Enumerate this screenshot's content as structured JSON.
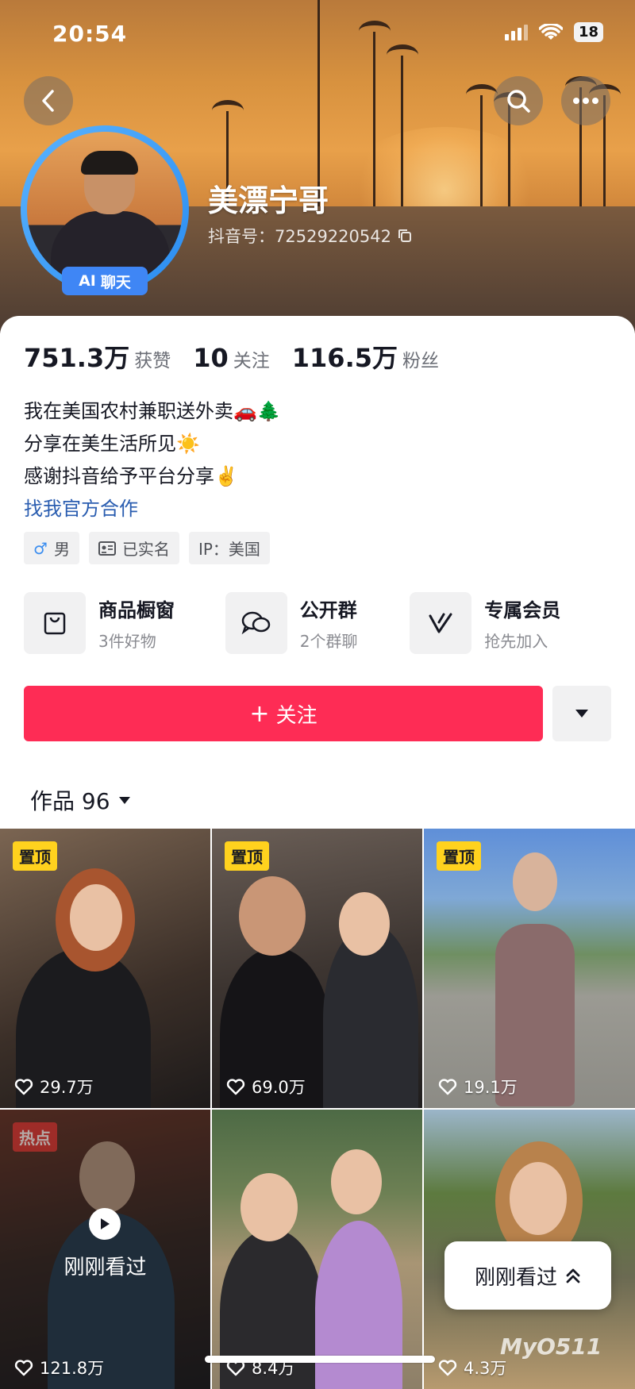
{
  "status": {
    "time": "20:54",
    "battery": "18"
  },
  "profile": {
    "name": "美漂宁哥",
    "douyin_id": "抖音号：72529220542",
    "ai_chat": "聊天",
    "ai_prefix": "AI"
  },
  "stats": [
    {
      "num": "751.3万",
      "label": "获赞"
    },
    {
      "num": "10",
      "label": "关注"
    },
    {
      "num": "116.5万",
      "label": "粉丝"
    }
  ],
  "bio": {
    "line1": "我在美国农村兼职送外卖🚗🌲",
    "line2": "分享在美生活所见☀️",
    "line3": "感谢抖音给予平台分享✌️",
    "link": "找我官方合作"
  },
  "tags": {
    "gender_symbol": "♂",
    "gender": "男",
    "verified": "已实名",
    "ip": "IP：美国"
  },
  "features": [
    {
      "title": "商品橱窗",
      "sub": "3件好物",
      "icon": "shopping-bag-icon"
    },
    {
      "title": "公开群",
      "sub": "2个群聊",
      "icon": "chat-bubbles-icon"
    },
    {
      "title": "专属会员",
      "sub": "抢先加入",
      "icon": "v-membership-icon"
    }
  ],
  "follow_label": "关注",
  "follow_plus": "+",
  "works": {
    "label": "作品 96"
  },
  "videos": [
    {
      "badge": "置顶",
      "likes": "29.7万"
    },
    {
      "badge": "置顶",
      "likes": "69.0万"
    },
    {
      "badge": "置顶",
      "likes": "19.1万"
    },
    {
      "badge": "热点",
      "likes": "121.8万",
      "seen": "刚刚看过"
    },
    {
      "badge": "",
      "likes": "8.4万"
    },
    {
      "badge": "",
      "likes": "4.3万"
    }
  ],
  "float_seen": "刚刚看过",
  "watermark": "MyO511"
}
